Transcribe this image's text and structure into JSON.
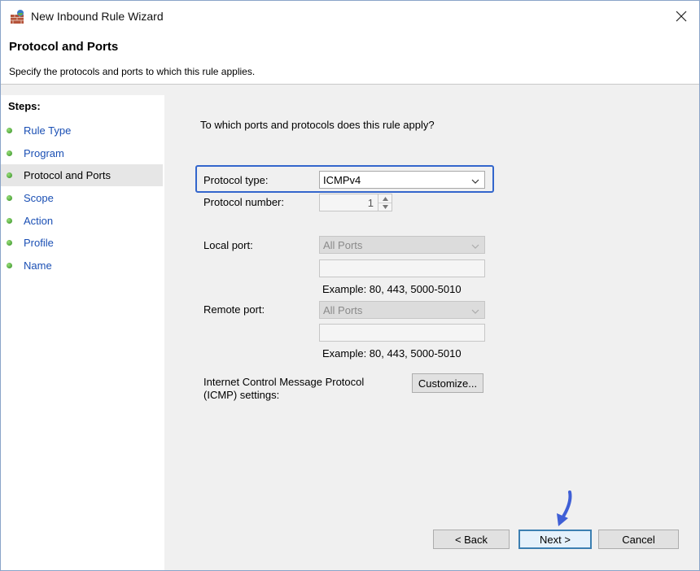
{
  "window": {
    "title": "New Inbound Rule Wizard",
    "close_icon": "close-icon",
    "app_icon": "firewall-wall-icon"
  },
  "header": {
    "title": "Protocol and Ports",
    "subtitle": "Specify the protocols and ports to which this rule applies."
  },
  "steps": {
    "label": "Steps:",
    "items": [
      {
        "label": "Rule Type",
        "active": false
      },
      {
        "label": "Program",
        "active": false
      },
      {
        "label": "Protocol and Ports",
        "active": true
      },
      {
        "label": "Scope",
        "active": false
      },
      {
        "label": "Action",
        "active": false
      },
      {
        "label": "Profile",
        "active": false
      },
      {
        "label": "Name",
        "active": false
      }
    ]
  },
  "main": {
    "question": "To which ports and protocols does this rule apply?",
    "protocol_type": {
      "label": "Protocol type:",
      "value": "ICMPv4"
    },
    "protocol_number": {
      "label": "Protocol number:",
      "value": "1"
    },
    "local_port": {
      "label": "Local port:",
      "value": "All Ports",
      "example": "Example: 80, 443, 5000-5010"
    },
    "remote_port": {
      "label": "Remote port:",
      "value": "All Ports",
      "example": "Example: 80, 443, 5000-5010"
    },
    "icmp": {
      "label_line1": "Internet Control Message Protocol",
      "label_line2": "(ICMP) settings:",
      "button": "Customize..."
    }
  },
  "footer": {
    "back": "< Back",
    "next": "Next >",
    "cancel": "Cancel"
  },
  "colors": {
    "highlight": "#3366cc",
    "step_link": "#1a4fb4",
    "annotation_arrow": "#3f5fd6"
  }
}
